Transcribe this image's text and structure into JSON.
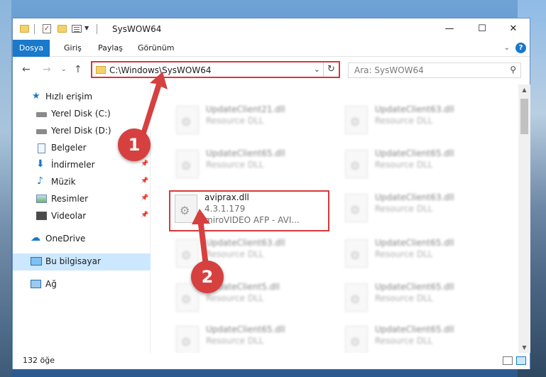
{
  "window": {
    "title": "SysWOW64",
    "controls": {
      "minimize": "—",
      "maximize": "☐",
      "close": "✕"
    }
  },
  "ribbon": {
    "tabs": [
      "Dosya",
      "Giriş",
      "Paylaş",
      "Görünüm"
    ],
    "help": "?"
  },
  "address": {
    "path": "C:\\Windows\\SysWOW64",
    "search_placeholder": "Ara: SysWOW64"
  },
  "nav": {
    "items": [
      {
        "label": "Hızlı erişim",
        "icon": "star-icon"
      },
      {
        "label": "Yerel Disk (C:)",
        "icon": "drive-icon"
      },
      {
        "label": "Yerel Disk (D:)",
        "icon": "drive-icon"
      },
      {
        "label": "Belgeler",
        "icon": "document-icon"
      },
      {
        "label": "İndirmeler",
        "icon": "download-icon"
      },
      {
        "label": "Müzik",
        "icon": "music-icon"
      },
      {
        "label": "Resimler",
        "icon": "pictures-icon"
      },
      {
        "label": "Videolar",
        "icon": "video-icon"
      },
      {
        "label": "OneDrive",
        "icon": "cloud-icon"
      },
      {
        "label": "Bu bilgisayar",
        "icon": "computer-icon"
      },
      {
        "label": "Ağ",
        "icon": "network-icon"
      }
    ]
  },
  "files": {
    "left": [
      {
        "name": "UpdateClient21.dll",
        "desc": "Resource DLL"
      },
      {
        "name": "UpdateClient65.dll",
        "desc": "Resource DLL"
      },
      {
        "name": "aviprax.dll",
        "desc": "4.3.1.179",
        "desc2": "miroVIDEO AFP - AVI..."
      },
      {
        "name": "UpdateClient63.dll",
        "desc": "Resource DLL"
      },
      {
        "name": "UpdateClient5.dll",
        "desc": "Resource DLL"
      },
      {
        "name": "UpdateClient65.dll",
        "desc": "Resource DLL"
      }
    ],
    "right": [
      {
        "name": "UpdateClient63.dll",
        "desc": "Resource DLL"
      },
      {
        "name": "UpdateClient65.dll",
        "desc": "Resource DLL"
      },
      {
        "name": "UpdateClient63.dll",
        "desc": "Resource DLL"
      },
      {
        "name": "UpdateClient65.dll",
        "desc": "Resource DLL"
      },
      {
        "name": "UpdateClient65.dll",
        "desc": "Resource DLL"
      },
      {
        "name": "UpdateClient65.dll",
        "desc": "Resource DLL"
      }
    ]
  },
  "status": {
    "count": "132 öğe"
  },
  "annotations": {
    "marker1": "1",
    "marker2": "2",
    "color": "#d6403f"
  }
}
